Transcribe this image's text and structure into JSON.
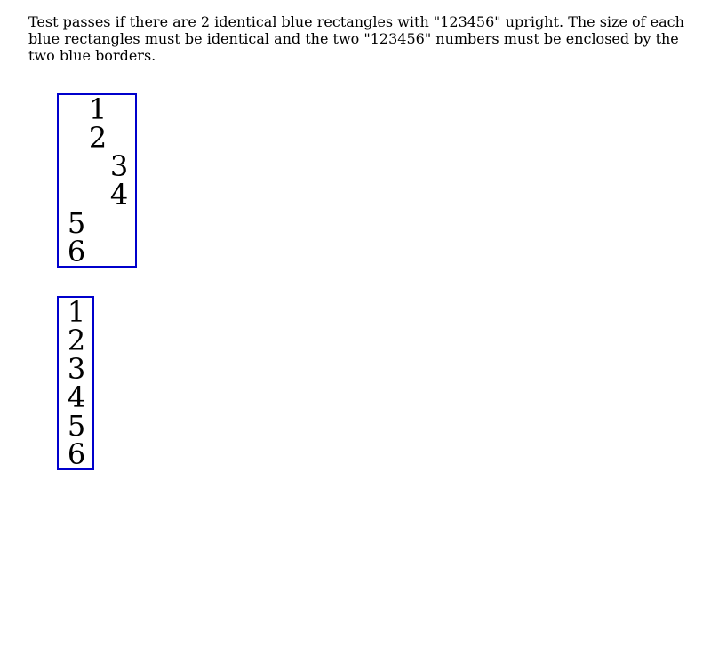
{
  "instructions": "Test passes if there are 2 identical blue rectangles with \"123456\" upright. The size of each blue rectangles must be identical and the two \"123456\" numbers must be enclosed by the two blue borders.",
  "colors": {
    "border": "#0000cc",
    "text": "#000000",
    "background": "#ffffff"
  },
  "first_box": {
    "digits": [
      "1",
      "2",
      "3",
      "4",
      "5",
      "6"
    ]
  },
  "second_box": {
    "digits": [
      "1",
      "2",
      "3",
      "4",
      "5",
      "6"
    ]
  }
}
